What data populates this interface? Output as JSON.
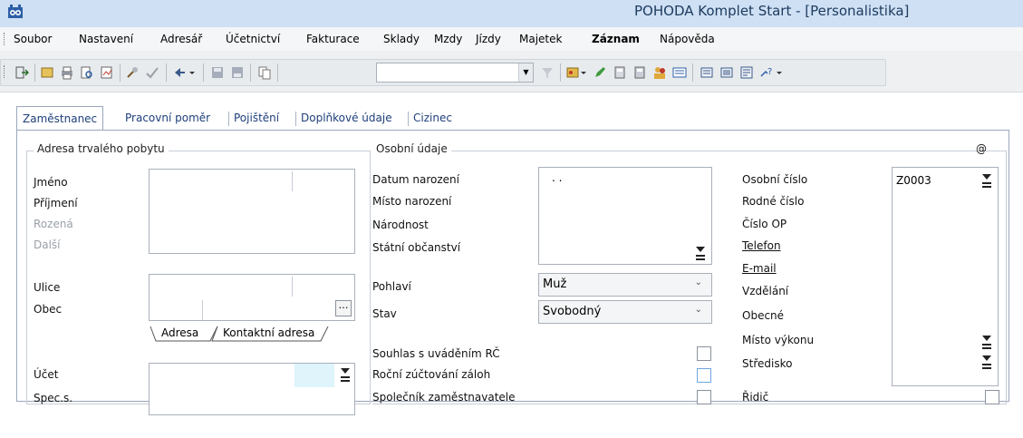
{
  "window": {
    "title": "POHODA Komplet Start - [Personalistika]"
  },
  "menu": [
    "Soubor",
    "Nastavení",
    "Adresář",
    "Účetnictví",
    "Fakturace",
    "Sklady",
    "Mzdy",
    "Jízdy",
    "Majetek",
    "Záznam",
    "Nápověda"
  ],
  "tabs": [
    "Zaměstnanec",
    "Pracovní poměr",
    "Pojištění",
    "Doplňkové údaje",
    "Cizinec"
  ],
  "address_group": {
    "title": "Adresa trvalého pobytu",
    "labels": [
      "Jméno",
      "Příjmení",
      "Rozená",
      "Další",
      "Ulice",
      "Obec",
      "Účet",
      "Spec.s."
    ],
    "subtabs": [
      "Adresa",
      "Kontaktní adresa"
    ]
  },
  "personal_group": {
    "title": "Osobní údaje",
    "labels": [
      "Datum narození",
      "Místo narození",
      "Národnost",
      "Státní občanství",
      "Pohlaví",
      "Stav"
    ],
    "date_value": ". .",
    "gender_value": "Muž",
    "status_value": "Svobodný",
    "checks": [
      "Souhlas s uváděním RČ",
      "Roční zúčtování záloh",
      "Společník zaměstnavatele"
    ]
  },
  "right_group": {
    "labels": [
      "Osobní číslo",
      "Rodné číslo",
      "Číslo OP",
      "Telefon",
      "E-mail",
      "Vzdělání",
      "Obecné",
      "Místo výkonu",
      "Středisko"
    ],
    "employee_number": "Z0003",
    "driver_label": "Řidič",
    "at_symbol": "@"
  }
}
